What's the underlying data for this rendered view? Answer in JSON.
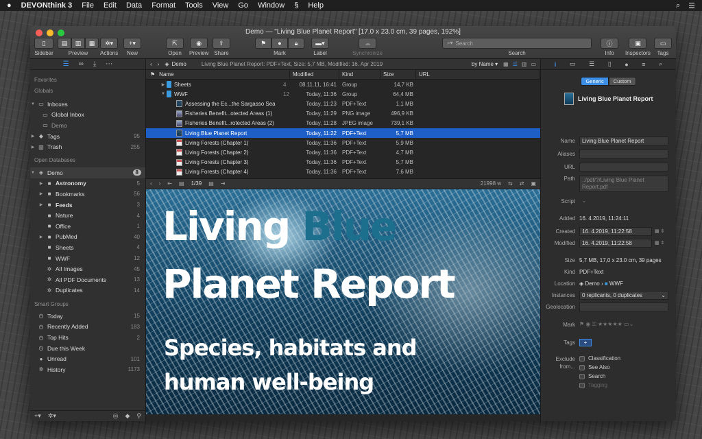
{
  "menubar": {
    "apple": "",
    "app": "DEVONthink 3",
    "items": [
      "File",
      "Edit",
      "Data",
      "Format",
      "Tools",
      "View",
      "Go",
      "Window",
      "Help"
    ],
    "script_icon": "script-icon"
  },
  "window": {
    "title": "Demo — \"Living Blue Planet Report\" [17.0 x 23.0 cm, 39 pages, 192%]",
    "toolbar": {
      "sidebar": "Sidebar",
      "preview": "Preview",
      "actions": "Actions",
      "new": "New",
      "open": "Open",
      "preview2": "Preview",
      "share": "Share",
      "mark": "Mark",
      "label": "Label",
      "synchronize": "Synchronize",
      "search_placeholder": "Search",
      "search": "Search",
      "info": "Info",
      "inspectors": "Inspectors",
      "tags": "Tags"
    }
  },
  "sidebar": {
    "favorites": "Favorites",
    "globals": "Globals",
    "globals_items": [
      {
        "label": "Inboxes",
        "count": ""
      },
      {
        "label": "Global Inbox",
        "count": ""
      },
      {
        "label": "Demo",
        "count": ""
      },
      {
        "label": "Tags",
        "count": "95"
      },
      {
        "label": "Trash",
        "count": "255"
      }
    ],
    "open_databases": "Open Databases",
    "db_items": [
      {
        "label": "Demo",
        "count": "8"
      },
      {
        "label": "Astronomy",
        "count": "5"
      },
      {
        "label": "Bookmarks",
        "count": "56"
      },
      {
        "label": "Feeds",
        "count": "3"
      },
      {
        "label": "Nature",
        "count": "4"
      },
      {
        "label": "Office",
        "count": "1"
      },
      {
        "label": "PubMed",
        "count": "40"
      },
      {
        "label": "Sheets",
        "count": "4"
      },
      {
        "label": "WWF",
        "count": "12"
      },
      {
        "label": "All Images",
        "count": "45"
      },
      {
        "label": "All PDF Documents",
        "count": "13"
      },
      {
        "label": "Duplicates",
        "count": "14"
      }
    ],
    "smart_groups": "Smart Groups",
    "smart_items": [
      {
        "label": "Today",
        "count": "15"
      },
      {
        "label": "Recently Added",
        "count": "183"
      },
      {
        "label": "Top Hits",
        "count": "2"
      },
      {
        "label": "Due this Week",
        "count": ""
      },
      {
        "label": "Unread",
        "count": "101"
      },
      {
        "label": "History",
        "count": "1173"
      }
    ]
  },
  "pathbar": {
    "location": "Demo",
    "info": "Living Blue Planet Report: PDF+Text, Size: 5,7 MB, Modified: 16. Apr 2019",
    "sort": "by Name"
  },
  "list": {
    "columns": {
      "name": "Name",
      "modified": "Modified",
      "kind": "Kind",
      "size": "Size",
      "url": "URL"
    },
    "rows": [
      {
        "name": "Sheets",
        "count": "4",
        "modified": "08.11.11, 16:41",
        "kind": "Group",
        "size": "14,7 KB"
      },
      {
        "name": "WWF",
        "count": "12",
        "modified": "Today, 11:36",
        "kind": "Group",
        "size": "64,4 MB"
      },
      {
        "name": "Assessing the Ec...the Sargasso Sea",
        "count": "",
        "modified": "Today, 11:23",
        "kind": "PDF+Text",
        "size": "1,1 MB"
      },
      {
        "name": "Fisheries Benefit...otected Areas (1)",
        "count": "",
        "modified": "Today, 11:29",
        "kind": "PNG image",
        "size": "496,9 KB"
      },
      {
        "name": "Fisheries Benefit...rotected Areas (2)",
        "count": "",
        "modified": "Today, 11:28",
        "kind": "JPEG image",
        "size": "739,1 KB"
      },
      {
        "name": "Living Blue Planet Report",
        "count": "",
        "modified": "Today, 11:22",
        "kind": "PDF+Text",
        "size": "5,7 MB"
      },
      {
        "name": "Living Forests (Chapter 1)",
        "count": "",
        "modified": "Today, 11:36",
        "kind": "PDF+Text",
        "size": "5,9 MB"
      },
      {
        "name": "Living Forests (Chapter 2)",
        "count": "",
        "modified": "Today, 11:36",
        "kind": "PDF+Text",
        "size": "4,7 MB"
      },
      {
        "name": "Living Forests (Chapter 3)",
        "count": "",
        "modified": "Today, 11:36",
        "kind": "PDF+Text",
        "size": "5,7 MB"
      },
      {
        "name": "Living Forests (Chapter 4)",
        "count": "",
        "modified": "Today, 11:36",
        "kind": "PDF+Text",
        "size": "7,6 MB"
      }
    ]
  },
  "docbar": {
    "page": "1/39",
    "words": "21998 w"
  },
  "preview": {
    "line1a": "Living",
    "line1b": "Blue",
    "line2": "Planet Report",
    "line3": "Species, habitats and",
    "line4": "human well-being"
  },
  "inspector": {
    "tab_generic": "Generic",
    "tab_custom": "Custom",
    "doc_title": "Living Blue Planet Report",
    "name_label": "Name",
    "name_value": "Living Blue Planet Report",
    "aliases_label": "Aliases",
    "url_label": "URL",
    "path_label": "Path",
    "path_value": "../pdf/?/Living Blue Planet Report.pdf",
    "script_label": "Script",
    "added_label": "Added",
    "added_value": "16.  4.2019, 11:24:11",
    "created_label": "Created",
    "created_value": "16.  4.2019, 11:22:58",
    "modified_label": "Modified",
    "modified_value": "16.  4.2019, 11:22:58",
    "size_label": "Size",
    "size_value": "5,7 MB, 17,0 x 23.0 cm, 39 pages",
    "kind_label": "Kind",
    "kind_value": "PDF+Text",
    "location_label": "Location",
    "location_db": "Demo",
    "location_group": "WWF",
    "instances_label": "Instances",
    "instances_value": "0 replicants, 0 duplicates",
    "geolocation_label": "Geolocation",
    "mark_label": "Mark",
    "tags_label": "Tags",
    "tags_add": "+",
    "exclude_label": "Exclude from...",
    "exclude_items": [
      "Classification",
      "See Also",
      "Search",
      "Tagging"
    ]
  },
  "colors": {
    "accent": "#3d8ee6",
    "selection": "#1d5fc7",
    "blue_title": "#1c6f8d"
  }
}
